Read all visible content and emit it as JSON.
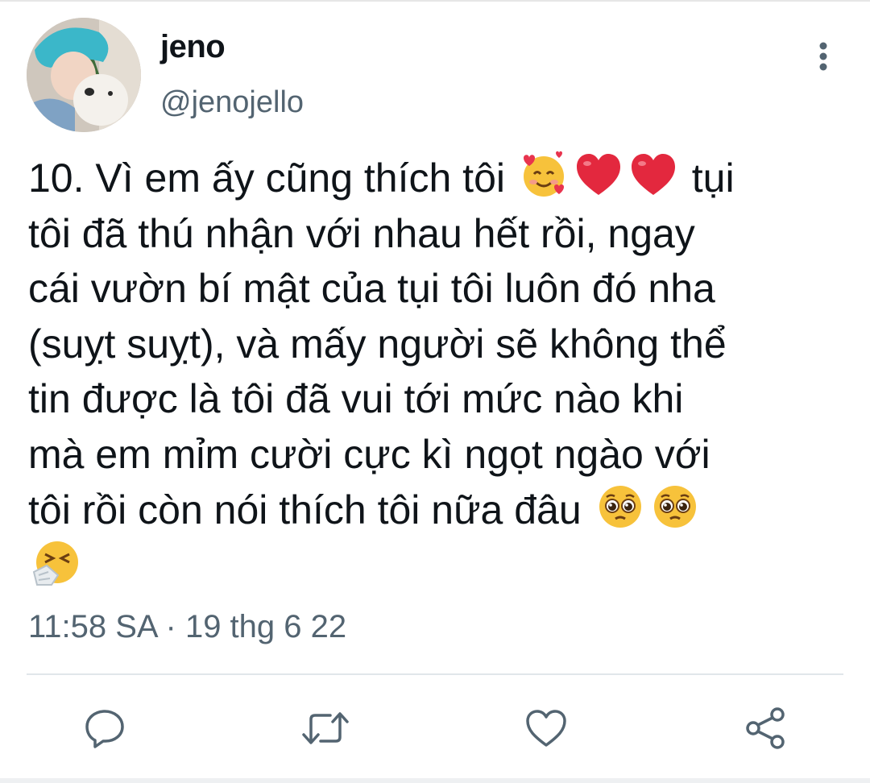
{
  "user": {
    "display_name": "jeno",
    "handle": "@jenojello",
    "avatar": "profile-photo-teal-hair-with-white-dog"
  },
  "tweet": {
    "line1_a": "10. Vì em ấy cũng thích tôi ",
    "line1_b": " tụi",
    "line2": "tôi đã thú nhận với nhau hết rồi, ngay",
    "line3": "cái vườn bí mật của tụi tôi luôn đó nha",
    "line4": "(suỵt suỵt), và mấy người sẽ không thể",
    "line5": "tin được là tôi đã vui tới mức nào khi",
    "line6": "mà em mỉm cười cực kì ngọt ngào với",
    "line7": "tôi rồi còn nói thích tôi nữa đâu ",
    "emojis": [
      "smiling-face-with-hearts",
      "red-heart",
      "red-heart",
      "pleading-face",
      "pleading-face",
      "sneezing-face"
    ]
  },
  "timestamp": "11:58 SA · 19 thg 6 22",
  "actions": {
    "icons": [
      "reply-icon",
      "retweet-icon",
      "like-icon",
      "share-icon"
    ]
  },
  "colors": {
    "text": "#0f1419",
    "secondary": "#536471",
    "divider": "#e1e6ea"
  }
}
